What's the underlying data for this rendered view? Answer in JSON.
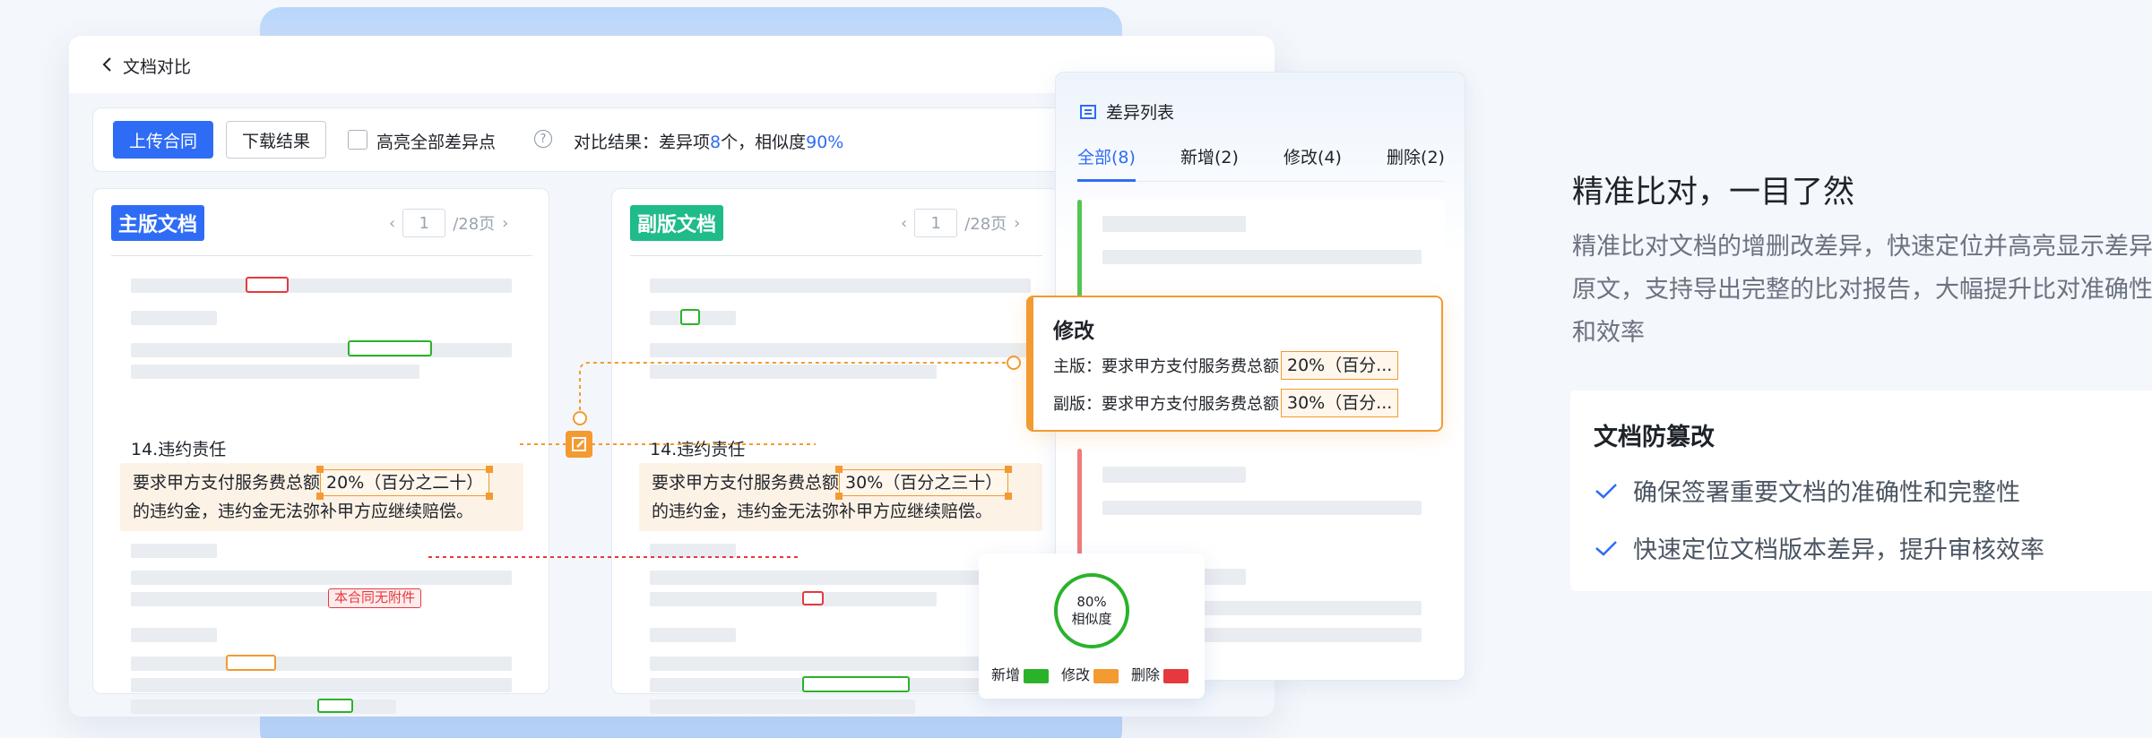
{
  "app": {
    "title": "文档对比"
  },
  "toolbar": {
    "upload_label": "上传合同",
    "download_label": "下载结果",
    "highlight_label": "高亮全部差异点",
    "help_icon": "?",
    "result_prefix": "对比结果：差异项",
    "diff_count": "8",
    "result_mid": "个，相似度",
    "similarity": "90%"
  },
  "main_doc": {
    "tag": "主版文档",
    "page": "1",
    "total": "/28页",
    "clause_title": "14.违约责任",
    "clause_before": "要求甲方支付服务费总额",
    "clause_highlight": "20%（百分之二十）",
    "clause_after": "的违约金，违约金无法弥补甲方应继续赔偿。",
    "note_label": "本合同无附件"
  },
  "sub_doc": {
    "tag": "副版文档",
    "page": "1",
    "total": "/28页",
    "clause_title": "14.违约责任",
    "clause_before": "要求甲方支付服务费总额",
    "clause_highlight": "30%（百分之三十）",
    "clause_after": "的违约金，违约金无法弥补甲方应继续赔偿。"
  },
  "diff_list": {
    "title": "差异列表",
    "tabs": [
      {
        "label": "全部(8)"
      },
      {
        "label": "新增(2)"
      },
      {
        "label": "修改(4)"
      },
      {
        "label": "删除(2)"
      }
    ]
  },
  "popup": {
    "title": "修改",
    "main_label": "主版：要求甲方支付服务费总额",
    "main_value": "20%（百分...",
    "sub_label": "副版：要求甲方支付服务费总额",
    "sub_value": "30%（百分..."
  },
  "similarity_card": {
    "value": "80%",
    "label": "相似度",
    "legend": [
      {
        "label": "新增",
        "color": "#2ab32a"
      },
      {
        "label": "修改",
        "color": "#f39a30"
      },
      {
        "label": "删除",
        "color": "#e6393d"
      }
    ]
  },
  "feature": {
    "title": "精准比对，一目了然",
    "desc": "精准比对文档的增删改差异，快速定位并高亮显示差异原文，支持导出完整的比对报告，大幅提升比对准确性和效率",
    "card_title": "文档防篡改",
    "items": [
      {
        "text": "确保签署重要文档的准确性和完整性"
      },
      {
        "text": "快速定位文档版本差异，提升审核效率"
      }
    ]
  },
  "colors": {
    "primary": "#2f6cf6",
    "green": "#1fbb8a",
    "orange": "#f39a30",
    "red": "#e6393d"
  }
}
